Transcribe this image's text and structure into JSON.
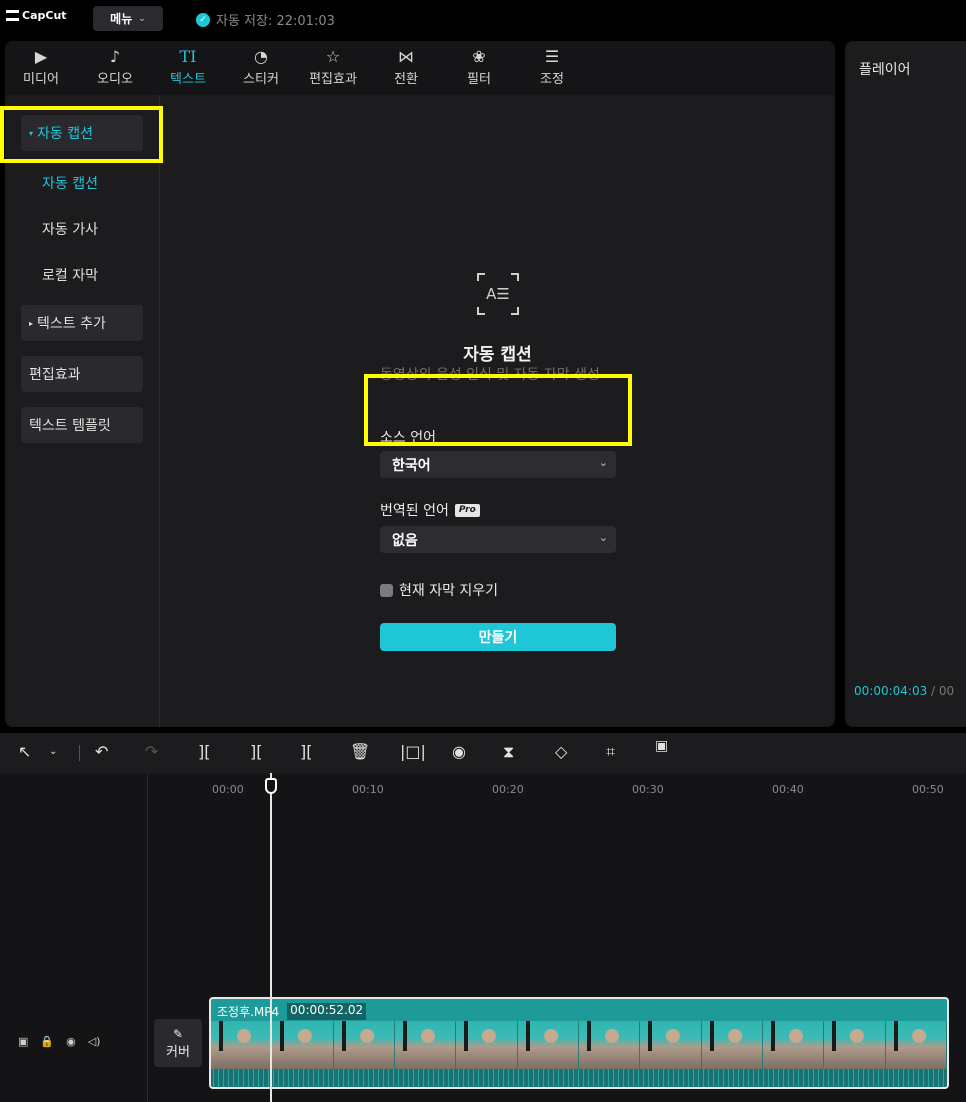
{
  "app": {
    "logo": "CapCut",
    "menu_label": "메뉴",
    "autosave": "자동 저장: 22:01:03"
  },
  "tabs": [
    {
      "label": "미디어",
      "icon": "media-icon"
    },
    {
      "label": "오디오",
      "icon": "audio-icon"
    },
    {
      "label": "텍스트",
      "icon": "text-icon",
      "active": true
    },
    {
      "label": "스티커",
      "icon": "sticker-icon"
    },
    {
      "label": "편집효과",
      "icon": "effects-icon"
    },
    {
      "label": "전환",
      "icon": "transition-icon"
    },
    {
      "label": "필터",
      "icon": "filter-icon"
    },
    {
      "label": "조정",
      "icon": "adjust-icon"
    }
  ],
  "sidebar": {
    "auto_caption_group": "자동 캡션",
    "sub_items": [
      "자동 캡션",
      "자동 가사",
      "로컬 자막"
    ],
    "add_text": "텍스트 추가",
    "effects": "편집효과",
    "templates": "텍스트 템플릿"
  },
  "content": {
    "icon": "auto-caption-icon",
    "title": "자동 캡션",
    "description": "동영상의 음성 인식 및 자동 자막 생성",
    "source_lang_label": "소스 언어",
    "source_lang_value": "한국어",
    "translated_lang_label": "번역된 언어",
    "pro_badge": "Pro",
    "translated_lang_value": "없음",
    "clear_checkbox_label": "현재 자막 지우기",
    "create_button": "만들기"
  },
  "player": {
    "title": "플레이어",
    "current_time": "00:00:04:03",
    "separator": "/ 00"
  },
  "timeline": {
    "ruler": [
      "00:00",
      "00:10",
      "00:20",
      "00:30",
      "00:40",
      "00:50"
    ],
    "cover_label": "커버",
    "clip_name": "조정후.MP4",
    "clip_duration": "00:00:52.02"
  },
  "colors": {
    "accent": "#1fc6d6",
    "highlight": "#ffff00"
  }
}
